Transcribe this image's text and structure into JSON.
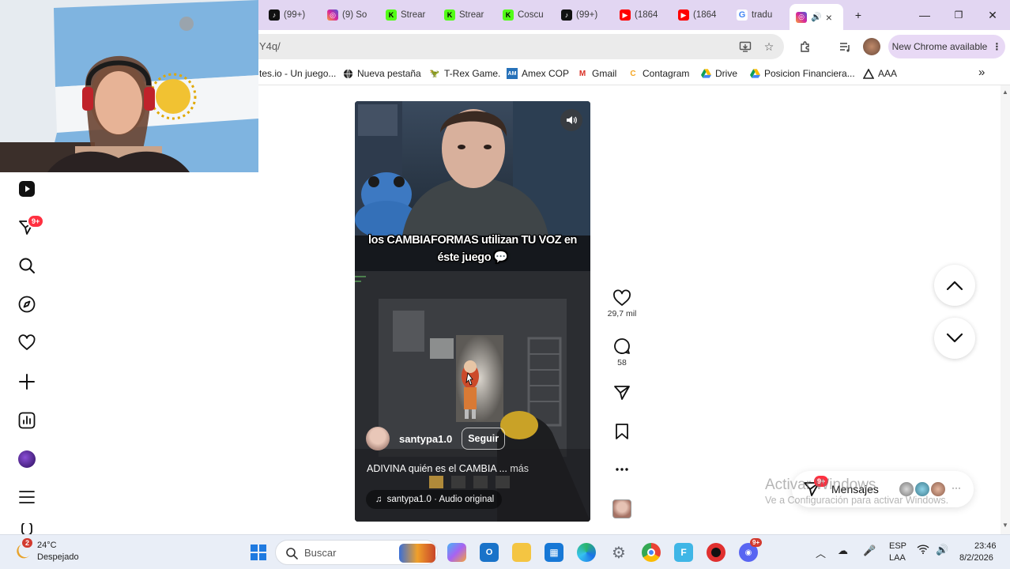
{
  "browser": {
    "tabs": [
      {
        "label": "(99+)",
        "icon": "tiktok-icon",
        "color": "#111111"
      },
      {
        "label": "(9) So",
        "icon": "instagram-icon",
        "color": "#d6249f"
      },
      {
        "label": "Strear",
        "icon": "kick-icon",
        "color": "#53fc18"
      },
      {
        "label": "Strear",
        "icon": "kick-icon",
        "color": "#53fc18"
      },
      {
        "label": "Coscu",
        "icon": "kick-icon",
        "color": "#53fc18"
      },
      {
        "label": "(99+)",
        "icon": "tiktok-icon",
        "color": "#111111"
      },
      {
        "label": "(1864",
        "icon": "youtube-icon",
        "color": "#ff0000"
      },
      {
        "label": "(1864",
        "icon": "youtube-icon",
        "color": "#ff0000"
      },
      {
        "label": "tradu",
        "icon": "google-icon",
        "color": "#4285f4"
      }
    ],
    "active_tab": {
      "icon": "instagram-icon",
      "audio": "speaker-icon",
      "close": "×"
    },
    "new_tab": "+",
    "window_controls": {
      "minimize": "—",
      "maximize": "❐",
      "close": "✕"
    },
    "url": "Y4q/",
    "new_chrome": "New Chrome available",
    "bookmarks": [
      {
        "label": "tes.io - Un juego...",
        "icon": ""
      },
      {
        "label": "Nueva pestaña",
        "icon": "globe-icon"
      },
      {
        "label": "T-Rex Game.",
        "icon": "dino-icon"
      },
      {
        "label": "Amex COP",
        "icon": "amex-icon"
      },
      {
        "label": "Gmail",
        "icon": "gmail-icon"
      },
      {
        "label": "Contagram",
        "icon": "contagram-icon"
      },
      {
        "label": "Drive",
        "icon": "drive-icon"
      },
      {
        "label": "Posicion Financiera...",
        "icon": "drive-icon"
      },
      {
        "label": "AAA",
        "icon": "triangle-icon"
      }
    ],
    "bookmarks_more": "»"
  },
  "reel": {
    "caption": "los CAMBIAFORMAS utilizan TU VOZ en éste juego",
    "username": "santypa1.0",
    "follow": "Seguir",
    "description": "ADIVINA quién es el CAMBIA ...",
    "more": "más",
    "audio": "santypa1.0 · Audio original"
  },
  "actions": {
    "likes": "29,7 mil",
    "comments": "58"
  },
  "messages": {
    "label": "Mensajes",
    "badge": "9+"
  },
  "sidebar": {
    "notification_badge": "9+"
  },
  "watermark": {
    "line1": "Activar Windows",
    "line2": "Ve a Configuración para activar Windows."
  },
  "taskbar": {
    "weather_temp": "24°C",
    "weather_desc": "Despejado",
    "weather_badge": "2",
    "search_placeholder": "Buscar",
    "discord_badge": "9+",
    "lang": "ESP",
    "lang2": "LAA",
    "time": "23:46",
    "date": "8/2/2026"
  },
  "colors": {
    "tabbar": "#e2d6f2",
    "instagram_badge": "#ff3040",
    "taskbar": "#e9eef7"
  }
}
